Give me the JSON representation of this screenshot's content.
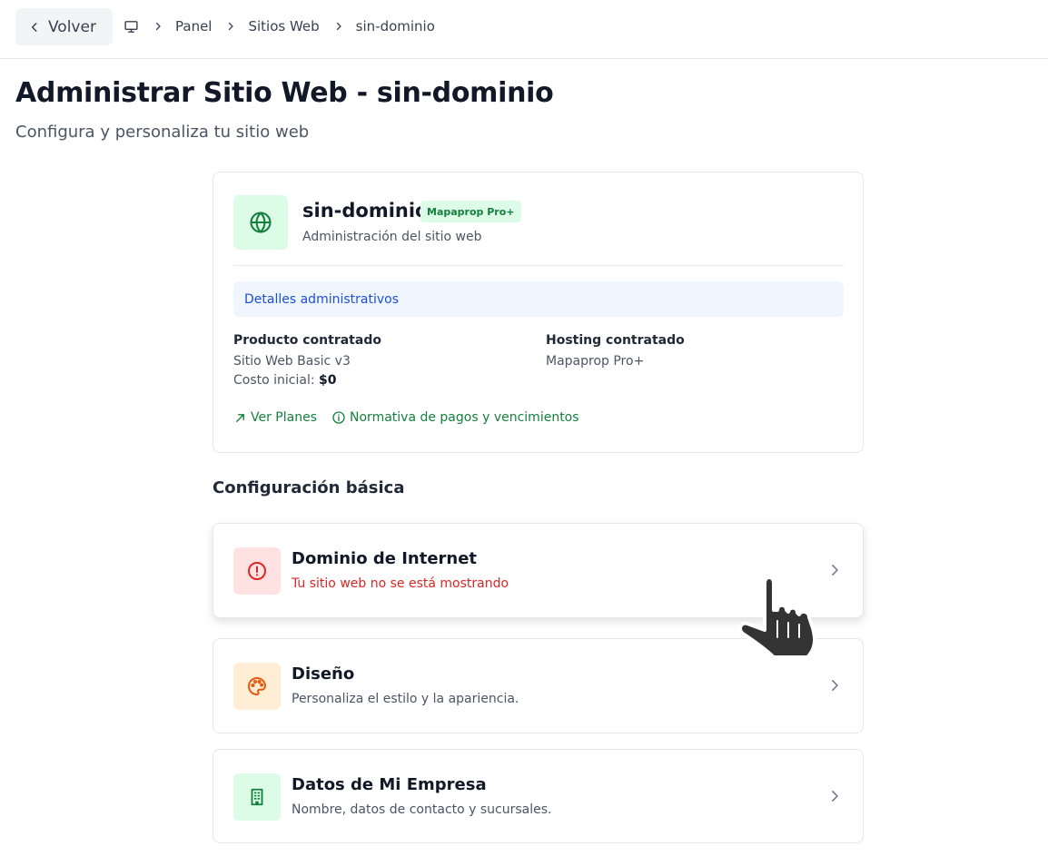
{
  "header": {
    "back_label": "Volver",
    "breadcrumbs": [
      "Panel",
      "Sitios Web",
      "sin-dominio"
    ]
  },
  "page": {
    "title": "Administrar Sitio Web - sin-dominio",
    "subtitle": "Configura y personaliza tu sitio web"
  },
  "site_card": {
    "name": "sin-dominio",
    "badge": "Mapaprop Pro+",
    "subtitle": "Administración del sitio web",
    "admin_details_label": "Detalles administrativos",
    "product_heading": "Producto contratado",
    "product_value": "Sitio Web Basic v3",
    "cost_label": "Costo inicial: ",
    "cost_value": "$0",
    "hosting_heading": "Hosting contratado",
    "hosting_value": "Mapaprop Pro+",
    "link_plans": "Ver Planes",
    "link_policy": "Normativa de pagos y vencimientos"
  },
  "basic_config": {
    "title": "Configuración básica",
    "items": [
      {
        "title": "Dominio de Internet",
        "description": "Tu sitio web no se está mostrando",
        "icon": "alert-circle-icon",
        "status": "error"
      },
      {
        "title": "Diseño",
        "description": "Personaliza el estilo y la apariencia.",
        "icon": "palette-icon"
      },
      {
        "title": "Datos de Mi Empresa",
        "description": "Nombre, datos de contacto y sucursales.",
        "icon": "building-icon"
      }
    ]
  },
  "colors": {
    "accent_green": "#15803d",
    "green_bg": "#dcfce7",
    "error_red": "#dc2626",
    "error_bg": "#fee2e2",
    "orange": "#ea580c",
    "orange_bg": "#ffedd5",
    "info_blue": "#1d4ed8",
    "info_bg": "#eff6ff"
  }
}
